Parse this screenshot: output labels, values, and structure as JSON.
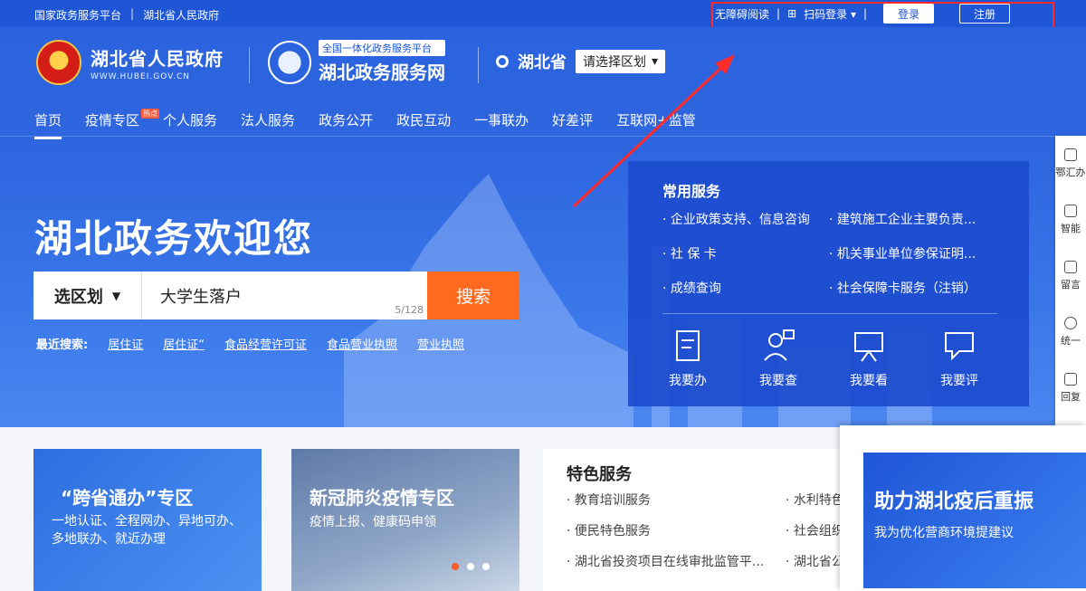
{
  "topbar": {
    "links": [
      "国家政务服务平台",
      "|",
      "湖北省人民政府"
    ],
    "accessibility": "无障碍阅读",
    "scan_login": "扫码登录 ▾",
    "login": "登录",
    "register": "注册"
  },
  "header": {
    "gov_name": "湖北省人民政府",
    "gov_url": "WWW.HUBEI.GOV.CN",
    "portal_tag": "全国一体化政务服务平台",
    "portal_name": "湖北政务服务网",
    "province": "湖北省",
    "region_select": "请选择区划"
  },
  "nav": {
    "items": [
      "首页",
      "疫情专区",
      "个人服务",
      "法人服务",
      "政务公开",
      "政民互动",
      "一事联办",
      "好差评",
      "互联网+监管"
    ],
    "hot_badge": "热点"
  },
  "hero": {
    "welcome": "湖北政务欢迎您",
    "search": {
      "region_label": "选区划",
      "query": "大学生落户",
      "counter": "5/128",
      "button": "搜索"
    },
    "recent": {
      "label": "最近搜索:",
      "items": [
        "居住证",
        "居住证“",
        "食品经营许可证",
        "食品营业执照",
        "营业执照"
      ]
    }
  },
  "services": {
    "title": "常用服务",
    "items": [
      "· 企业政策支持、信息咨询",
      "· 建筑施工企业主要负责...",
      "· 社 保 卡",
      "· 机关事业单位参保证明...",
      "· 成绩查询",
      "· 社会保障卡服务（注销）"
    ],
    "actions": [
      "我要办",
      "我要查",
      "我要看",
      "我要评"
    ]
  },
  "floatbar": {
    "items": [
      "鄂汇办",
      "智能",
      "留言",
      "统一",
      "回复"
    ]
  },
  "bottom": {
    "card1": {
      "title": "“跨省通办”专区",
      "desc": "一地认证、全程网办、异地可办、多地联办、就近办理"
    },
    "card2": {
      "title": "新冠肺炎疫情专区",
      "desc": "疫情上报、健康码申领"
    },
    "special": {
      "title": "特色服务",
      "left": [
        "· 教育培训服务",
        "· 便民特色服务",
        "· 湖北省投资项目在线审批监管平..."
      ],
      "right": [
        "· 水利特色",
        "· 社会组织",
        "· 湖北省公"
      ]
    },
    "popup": {
      "title": "助力湖北疫后重振",
      "desc": "我为优化营商环境提建议"
    }
  },
  "colors": {
    "primary": "#1f56d6",
    "accent": "#ff6a1f",
    "annotation": "#ff2a2a"
  }
}
